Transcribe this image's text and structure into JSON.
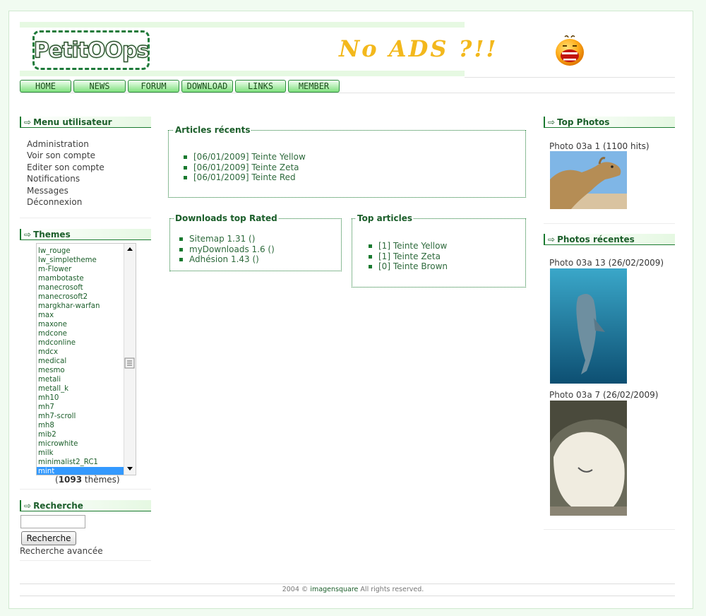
{
  "header": {
    "logo_text": "PetitOOps",
    "slogan": "No ADS ?!!"
  },
  "nav": [
    {
      "label": "HOME"
    },
    {
      "label": "NEWS"
    },
    {
      "label": "FORUM"
    },
    {
      "label": "DOWNLOAD"
    },
    {
      "label": "LINKS"
    },
    {
      "label": "MEMBER"
    }
  ],
  "user_menu": {
    "title": "Menu utilisateur",
    "items": [
      "Administration",
      "Voir son compte",
      "Editer son compte",
      "Notifications",
      "Messages",
      "Déconnexion"
    ]
  },
  "themes": {
    "title": "Themes",
    "items": [
      "lw_rouge",
      "lw_simpletheme",
      "m-Flower",
      "mambotaste",
      "manecrosoft",
      "manecrosoft2",
      "margkhar-warfan",
      "max",
      "maxone",
      "mdcone",
      "mdconline",
      "mdcx",
      "medical",
      "mesmo",
      "metali",
      "metall_k",
      "mh10",
      "mh7",
      "mh7-scroll",
      "mh8",
      "mib2",
      "microwhite",
      "milk",
      "minimalist2_RC1",
      "mint"
    ],
    "selected": "mint",
    "count_number": "1093",
    "count_suffix": " thèmes)",
    "count_prefix": "("
  },
  "search": {
    "title": "Recherche",
    "input_value": "",
    "button_label": "Recherche",
    "advanced_label": "Recherche avancée"
  },
  "articles_recents": {
    "title": "Articles récents",
    "items": [
      "[06/01/2009] Teinte Yellow",
      "[06/01/2009] Teinte Zeta",
      "[06/01/2009] Teinte Red"
    ]
  },
  "downloads_top": {
    "title": "Downloads top Rated",
    "items": [
      "Sitemap 1.31 ()",
      "myDownloads 1.6 ()",
      "Adhésion 1.43 ()"
    ]
  },
  "top_articles": {
    "title": "Top articles",
    "items": [
      "[1] Teinte Yellow",
      "[1] Teinte Zeta",
      "[0] Teinte Brown"
    ]
  },
  "top_photos": {
    "title": "Top Photos",
    "photo": {
      "name": "Photo 03a 1",
      "meta": " (1100 hits)"
    }
  },
  "recent_photos": {
    "title": "Photos récentes",
    "photos": [
      {
        "name": "Photo 03a 13",
        "meta": " (26/02/2009)"
      },
      {
        "name": "Photo 03a 7",
        "meta": " (26/02/2009)"
      }
    ]
  },
  "footer": {
    "prefix": "2004 © ",
    "brand": "imagensquare",
    "suffix": " All rights reserved."
  },
  "colors": {
    "accent": "#1a7a30",
    "nav_gradient_bottom": "#7fe07d",
    "selection": "#3399ff"
  }
}
